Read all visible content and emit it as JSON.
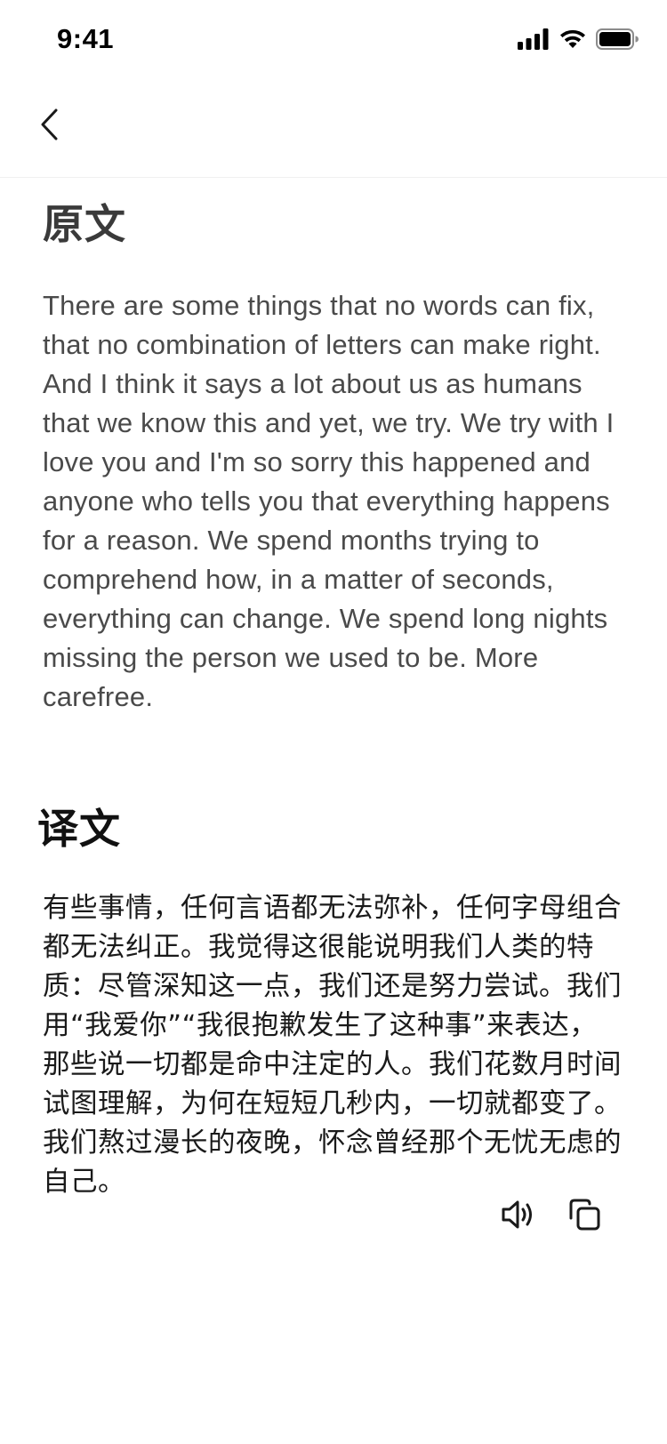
{
  "status_bar": {
    "time": "9:41",
    "icons": [
      "cellular-signal-icon",
      "wifi-icon",
      "battery-icon"
    ]
  },
  "nav": {
    "back_icon": "chevron-left-icon"
  },
  "original": {
    "title": "原文",
    "text": "There are some things that no words can fix, that no combination of letters can make right. And I think it says a lot about us as humans that we know this and yet, we try. We try with I love you and I'm so sorry this happened and anyone who tells you that everything happens for a reason. We spend months trying to comprehend how, in a matter of seconds, everything can change. We spend long nights missing the person we used to be. More carefree."
  },
  "translation": {
    "title": "译文",
    "text": "有些事情，任何言语都无法弥补，任何字母组合都无法纠正。我觉得这很能说明我们人类的特质：尽管深知这一点，我们还是努力尝试。我们用“我爱你”“我很抱歉发生了这种事”来表达，那些说一切都是命中注定的人。我们花数月时间试图理解，为何在短短几秒内，一切就都变了。我们熬过漫长的夜晚，怀念曾经那个无忧无虑的自己。"
  },
  "actions": {
    "icons": [
      "speaker-icon",
      "copy-icon"
    ]
  },
  "colors": {
    "background": "#ffffff",
    "text_primary": "#1a1a1a",
    "text_secondary": "#4a4a4a",
    "divider": "#f0f0f0"
  }
}
